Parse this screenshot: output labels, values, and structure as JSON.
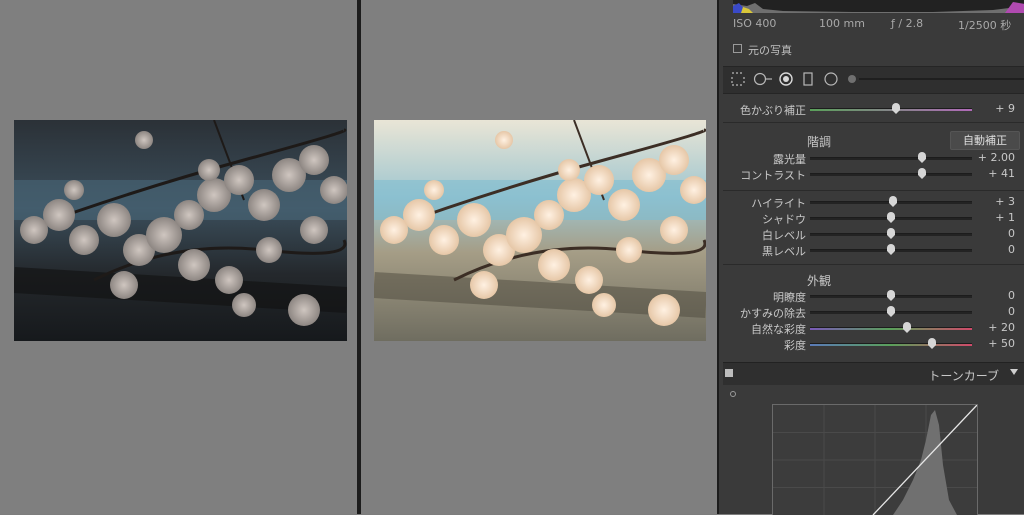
{
  "exif": {
    "iso": "ISO 400",
    "focal": "100 mm",
    "aperture": "ƒ / 2.8",
    "shutter": "1/2500 秒"
  },
  "original_photo_label": "元の写真",
  "tint": {
    "label": "色かぶり補正",
    "value": "+ 9",
    "position": 0.53
  },
  "tone": {
    "title": "階調",
    "auto_button": "自動補正",
    "sliders": [
      {
        "label": "露光量",
        "value": "+ 2.00",
        "position": 0.69
      },
      {
        "label": "コントラスト",
        "value": "+ 41",
        "position": 0.69
      },
      {
        "label": "ハイライト",
        "value": "+ 3",
        "position": 0.51
      },
      {
        "label": "シャドウ",
        "value": "+ 1",
        "position": 0.5
      },
      {
        "label": "白レベル",
        "value": "0",
        "position": 0.5
      },
      {
        "label": "黒レベル",
        "value": "0",
        "position": 0.5
      }
    ]
  },
  "presence": {
    "title": "外観",
    "sliders": [
      {
        "label": "明瞭度",
        "value": "0",
        "position": 0.5
      },
      {
        "label": "かすみの除去",
        "value": "0",
        "position": 0.5
      },
      {
        "label": "自然な彩度",
        "value": "+ 20",
        "position": 0.6
      },
      {
        "label": "彩度",
        "value": "+ 50",
        "position": 0.75
      }
    ]
  },
  "tone_curve": {
    "title": "トーンカーブ"
  },
  "colors": {
    "panel": "#3a3a3a",
    "canvas": "#7f7f7f",
    "thumb": "#d6d6d6"
  }
}
